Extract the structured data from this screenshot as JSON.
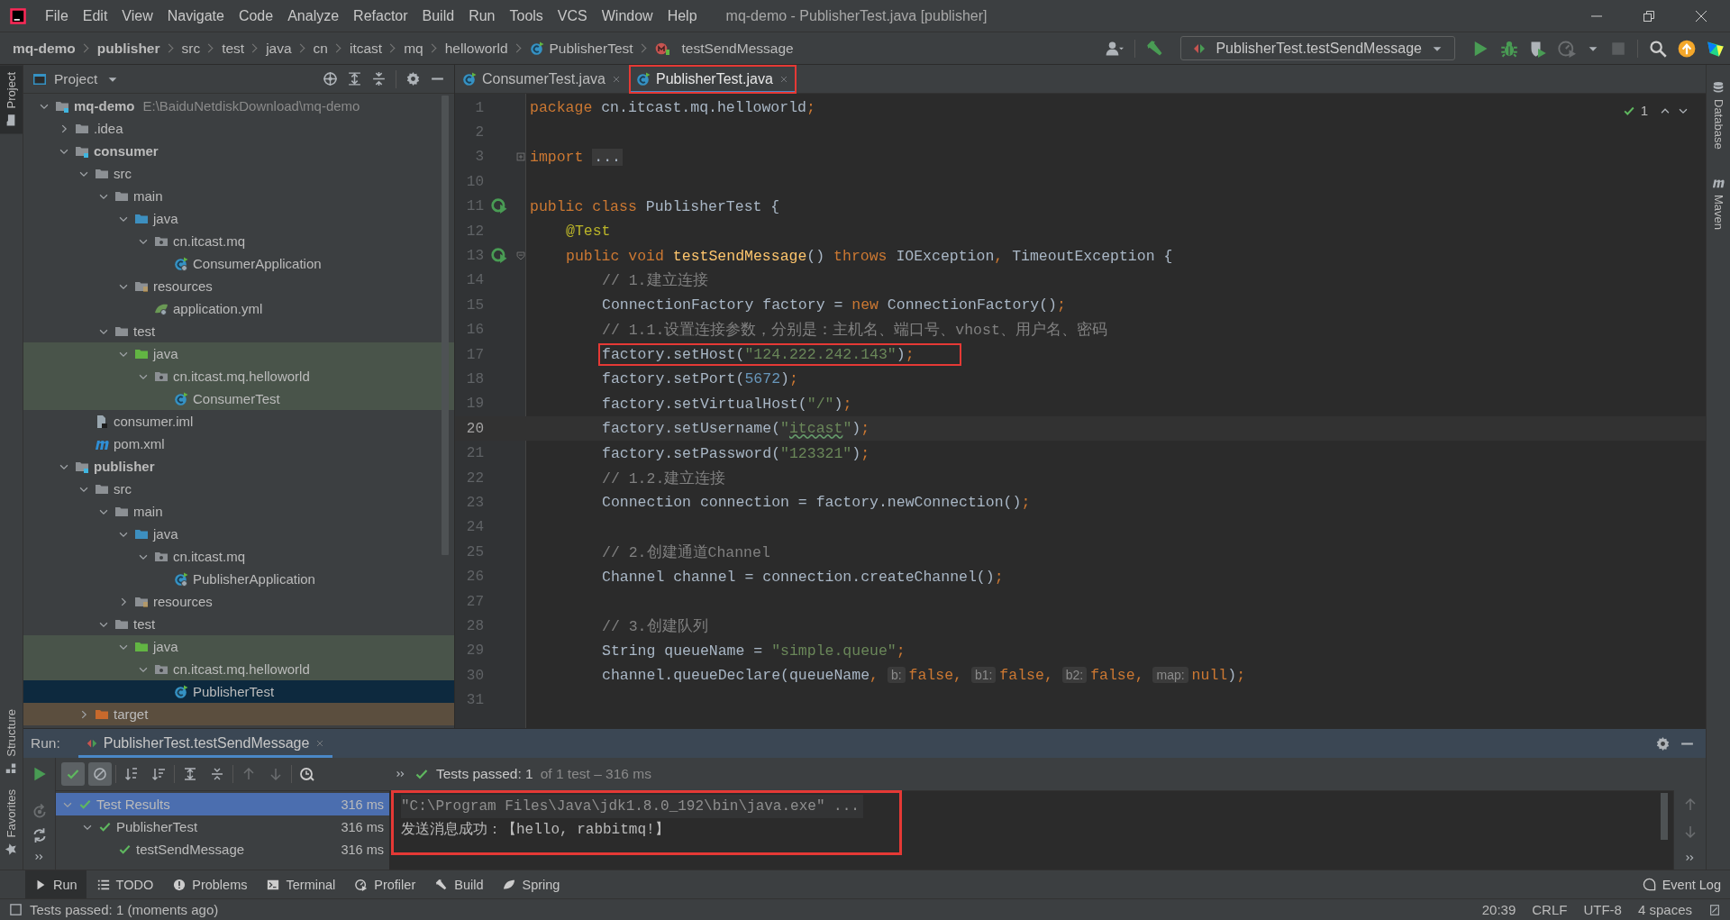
{
  "window": {
    "title": "mq-demo - PublisherTest.java [publisher]"
  },
  "menu": [
    "File",
    "Edit",
    "View",
    "Navigate",
    "Code",
    "Analyze",
    "Refactor",
    "Build",
    "Run",
    "Tools",
    "VCS",
    "Window",
    "Help"
  ],
  "breadcrumb": [
    {
      "label": "mq-demo",
      "kind": "project"
    },
    {
      "label": "publisher",
      "kind": "module"
    },
    {
      "label": "src",
      "kind": "dir"
    },
    {
      "label": "test",
      "kind": "dir"
    },
    {
      "label": "java",
      "kind": "dir"
    },
    {
      "label": "cn",
      "kind": "dir"
    },
    {
      "label": "itcast",
      "kind": "dir"
    },
    {
      "label": "mq",
      "kind": "dir"
    },
    {
      "label": "helloworld",
      "kind": "dir"
    },
    {
      "label": "PublisherTest",
      "kind": "class"
    },
    {
      "label": "testSendMessage",
      "kind": "method"
    }
  ],
  "run_config": {
    "label": "PublisherTest.testSendMessage"
  },
  "side_tools": {
    "left": [
      {
        "label": "Project",
        "selected": true
      },
      {
        "label": "Structure",
        "selected": false
      },
      {
        "label": "Favorites",
        "selected": false
      }
    ],
    "right": [
      {
        "label": "Database",
        "kind": "database"
      },
      {
        "label": "Maven",
        "kind": "maven"
      }
    ]
  },
  "project_panel": {
    "title": "Project",
    "tree": [
      {
        "label": "mq-demo",
        "kind": "project",
        "path": "E:\\BaiduNetdiskDownload\\mq-demo",
        "expanded": true,
        "selected": false,
        "children": [
          {
            "label": ".idea",
            "kind": "folder",
            "expanded": false,
            "selected": false
          },
          {
            "label": "consumer",
            "kind": "module",
            "expanded": true,
            "selected": false,
            "children": [
              {
                "label": "src",
                "kind": "folder",
                "expanded": true,
                "selected": false,
                "children": [
                  {
                    "label": "main",
                    "kind": "folder",
                    "expanded": true,
                    "selected": false,
                    "children": [
                      {
                        "label": "java",
                        "kind": "source_root",
                        "expanded": true,
                        "selected": false,
                        "children": [
                          {
                            "label": "cn.itcast.mq",
                            "kind": "package",
                            "expanded": true,
                            "selected": false,
                            "children": [
                              {
                                "label": "ConsumerApplication",
                                "kind": "spring_class",
                                "selected": false
                              }
                            ]
                          }
                        ]
                      },
                      {
                        "label": "resources",
                        "kind": "resources",
                        "expanded": true,
                        "selected": false,
                        "children": [
                          {
                            "label": "application.yml",
                            "kind": "yaml",
                            "selected": false
                          }
                        ]
                      }
                    ]
                  },
                  {
                    "label": "test",
                    "kind": "folder",
                    "expanded": true,
                    "selected": false,
                    "children": [
                      {
                        "label": "java",
                        "kind": "test_root",
                        "color": "#49544a",
                        "expanded": true,
                        "selected": false,
                        "children": [
                          {
                            "label": "cn.itcast.mq.helloworld",
                            "kind": "package",
                            "color": "#49544a",
                            "expanded": true,
                            "selected": false,
                            "children": [
                              {
                                "label": "ConsumerTest",
                                "kind": "test_class",
                                "color": "#49544a",
                                "selected": false
                              }
                            ]
                          }
                        ]
                      }
                    ]
                  }
                ]
              },
              {
                "label": "consumer.iml",
                "kind": "iml",
                "selected": false
              },
              {
                "label": "pom.xml",
                "kind": "maven",
                "selected": false
              }
            ]
          },
          {
            "label": "publisher",
            "kind": "module",
            "expanded": true,
            "selected": false,
            "children": [
              {
                "label": "src",
                "kind": "folder",
                "expanded": true,
                "selected": false,
                "children": [
                  {
                    "label": "main",
                    "kind": "folder",
                    "expanded": true,
                    "selected": false,
                    "children": [
                      {
                        "label": "java",
                        "kind": "source_root",
                        "expanded": true,
                        "selected": false,
                        "children": [
                          {
                            "label": "cn.itcast.mq",
                            "kind": "package",
                            "expanded": true,
                            "selected": false,
                            "children": [
                              {
                                "label": "PublisherApplication",
                                "kind": "spring_class",
                                "selected": false
                              }
                            ]
                          }
                        ]
                      },
                      {
                        "label": "resources",
                        "kind": "resources",
                        "expanded": false,
                        "selected": false
                      }
                    ]
                  },
                  {
                    "label": "test",
                    "kind": "folder",
                    "expanded": true,
                    "selected": false,
                    "children": [
                      {
                        "label": "java",
                        "kind": "test_root",
                        "color": "#49544a",
                        "expanded": true,
                        "selected": false,
                        "children": [
                          {
                            "label": "cn.itcast.mq.helloworld",
                            "kind": "package",
                            "color": "#49544a",
                            "expanded": true,
                            "selected": false,
                            "children": [
                              {
                                "label": "PublisherTest",
                                "kind": "test_class",
                                "selected": true
                              }
                            ]
                          }
                        ]
                      }
                    ]
                  }
                ]
              },
              {
                "label": "target",
                "kind": "excluded",
                "color": "#5b4e3e",
                "expanded": false,
                "selected": false
              }
            ]
          }
        ]
      }
    ]
  },
  "editor": {
    "tabs": [
      {
        "label": "ConsumerTest.java",
        "selected": false,
        "marked": false
      },
      {
        "label": "PublisherTest.java",
        "selected": true,
        "marked": true
      }
    ],
    "inspection": {
      "count": "1"
    },
    "lines": [
      {
        "number": "1",
        "current": false,
        "marked": false,
        "tokens": [
          {
            "kind": "kw",
            "text": "package "
          },
          {
            "kind": "p",
            "text": "cn.itcast.mq.helloworld"
          },
          {
            "kind": "kw",
            "text": ";"
          }
        ]
      },
      {
        "number": "2",
        "current": false,
        "marked": false
      },
      {
        "number": "3",
        "current": false,
        "marked": false,
        "folded": true,
        "tokens": [
          {
            "kind": "kw",
            "text": "import "
          },
          {
            "kind": "folded",
            "text": "..."
          }
        ]
      },
      {
        "number": "10",
        "current": false,
        "marked": false
      },
      {
        "number": "11",
        "current": false,
        "marked": false,
        "runnable": true,
        "tokens": [
          {
            "kind": "kw",
            "text": "public class "
          },
          {
            "kind": "p",
            "text": "PublisherTest {"
          }
        ],
        "children": [
          {
            "number": "12",
            "current": false,
            "marked": false,
            "tokens": [
              {
                "kind": "ann",
                "text": "@Test"
              }
            ]
          },
          {
            "number": "13",
            "current": false,
            "marked": false,
            "runnable": true,
            "foldable": true,
            "tokens": [
              {
                "kind": "kw",
                "text": "public void "
              },
              {
                "kind": "decl",
                "text": "testSendMessage"
              },
              {
                "kind": "p",
                "text": "() "
              },
              {
                "kind": "kw",
                "text": "throws "
              },
              {
                "kind": "p",
                "text": "IOException"
              },
              {
                "kind": "kw",
                "text": ", "
              },
              {
                "kind": "p",
                "text": "TimeoutException {"
              }
            ],
            "children": [
              {
                "number": "14",
                "current": false,
                "marked": false,
                "tokens": [
                  {
                    "kind": "cm",
                    "text": "// 1.建立连接"
                  }
                ]
              },
              {
                "number": "15",
                "current": false,
                "marked": false,
                "tokens": [
                  {
                    "kind": "p",
                    "text": "ConnectionFactory factory = "
                  },
                  {
                    "kind": "kw",
                    "text": "new "
                  },
                  {
                    "kind": "p",
                    "text": "ConnectionFactory()"
                  },
                  {
                    "kind": "kw",
                    "text": ";"
                  }
                ]
              },
              {
                "number": "16",
                "current": false,
                "marked": false,
                "tokens": [
                  {
                    "kind": "cm",
                    "text": "// 1.1.设置连接参数，分别是：主机名、端口号、vhost、用户名、密码"
                  }
                ]
              },
              {
                "number": "17",
                "current": false,
                "marked": true,
                "tokens": [
                  {
                    "kind": "p",
                    "text": "factory.setHost("
                  },
                  {
                    "kind": "str",
                    "text": "\"124.222.242.143\""
                  },
                  {
                    "kind": "p",
                    "text": ")"
                  },
                  {
                    "kind": "kw",
                    "text": ";"
                  }
                ]
              },
              {
                "number": "18",
                "current": false,
                "marked": false,
                "tokens": [
                  {
                    "kind": "p",
                    "text": "factory.setPort("
                  },
                  {
                    "kind": "num",
                    "text": "5672"
                  },
                  {
                    "kind": "p",
                    "text": ")"
                  },
                  {
                    "kind": "kw",
                    "text": ";"
                  }
                ]
              },
              {
                "number": "19",
                "current": false,
                "marked": false,
                "tokens": [
                  {
                    "kind": "p",
                    "text": "factory.setVirtualHost("
                  },
                  {
                    "kind": "str",
                    "text": "\"/\""
                  },
                  {
                    "kind": "p",
                    "text": ")"
                  },
                  {
                    "kind": "kw",
                    "text": ";"
                  }
                ]
              },
              {
                "number": "20",
                "current": true,
                "marked": false,
                "tokens": [
                  {
                    "kind": "p",
                    "text": "factory.setUsername("
                  },
                  {
                    "kind": "str",
                    "text": "\""
                  },
                  {
                    "kind": "typo",
                    "text": "itcast"
                  },
                  {
                    "kind": "str",
                    "text": "\""
                  },
                  {
                    "kind": "p",
                    "text": ")"
                  },
                  {
                    "kind": "kw",
                    "text": ";"
                  }
                ]
              },
              {
                "number": "21",
                "current": false,
                "marked": false,
                "tokens": [
                  {
                    "kind": "p",
                    "text": "factory.setPassword("
                  },
                  {
                    "kind": "str",
                    "text": "\"123321\""
                  },
                  {
                    "kind": "p",
                    "text": ")"
                  },
                  {
                    "kind": "kw",
                    "text": ";"
                  }
                ]
              },
              {
                "number": "22",
                "current": false,
                "marked": false,
                "tokens": [
                  {
                    "kind": "cm",
                    "text": "// 1.2.建立连接"
                  }
                ]
              },
              {
                "number": "23",
                "current": false,
                "marked": false,
                "tokens": [
                  {
                    "kind": "p",
                    "text": "Connection connection = factory.newConnection()"
                  },
                  {
                    "kind": "kw",
                    "text": ";"
                  }
                ]
              },
              {
                "number": "24",
                "current": false,
                "marked": false
              },
              {
                "number": "25",
                "current": false,
                "marked": false,
                "tokens": [
                  {
                    "kind": "cm",
                    "text": "// 2.创建通道Channel"
                  }
                ]
              },
              {
                "number": "26",
                "current": false,
                "marked": false,
                "tokens": [
                  {
                    "kind": "p",
                    "text": "Channel channel = connection.createChannel()"
                  },
                  {
                    "kind": "kw",
                    "text": ";"
                  }
                ]
              },
              {
                "number": "27",
                "current": false,
                "marked": false
              },
              {
                "number": "28",
                "current": false,
                "marked": false,
                "tokens": [
                  {
                    "kind": "cm",
                    "text": "// 3.创建队列"
                  }
                ]
              },
              {
                "number": "29",
                "current": false,
                "marked": false,
                "tokens": [
                  {
                    "kind": "p",
                    "text": "String queueName = "
                  },
                  {
                    "kind": "str",
                    "text": "\"simple.queue\""
                  },
                  {
                    "kind": "kw",
                    "text": ";"
                  }
                ]
              },
              {
                "number": "30",
                "current": false,
                "marked": false,
                "tokens": [
                  {
                    "kind": "p",
                    "text": "channel.queueDeclare(queueName"
                  },
                  {
                    "kind": "kw",
                    "text": ", "
                  },
                  {
                    "kind": "hint",
                    "text": "b:"
                  },
                  {
                    "kind": "kw",
                    "text": "false"
                  },
                  {
                    "kind": "kw",
                    "text": ", "
                  },
                  {
                    "kind": "hint",
                    "text": "b1:"
                  },
                  {
                    "kind": "kw",
                    "text": "false"
                  },
                  {
                    "kind": "kw",
                    "text": ", "
                  },
                  {
                    "kind": "hint",
                    "text": "b2:"
                  },
                  {
                    "kind": "kw",
                    "text": "false"
                  },
                  {
                    "kind": "kw",
                    "text": ", "
                  },
                  {
                    "kind": "hint",
                    "text": "map:"
                  },
                  {
                    "kind": "kw",
                    "text": "null"
                  },
                  {
                    "kind": "p",
                    "text": ")"
                  },
                  {
                    "kind": "kw",
                    "text": ";"
                  }
                ]
              },
              {
                "number": "31",
                "current": false,
                "marked": false
              }
            ]
          }
        ]
      }
    ]
  },
  "run_panel": {
    "title": "Run:",
    "tab": {
      "label": "PublisherTest.testSendMessage"
    },
    "toolbar": [
      {
        "kind": "passed",
        "on": true
      },
      {
        "kind": "ignored",
        "on": true
      },
      {
        "kind": "sort_alpha",
        "on": false
      },
      {
        "kind": "sort_duration",
        "on": false
      },
      {
        "kind": "expand",
        "on": false
      },
      {
        "kind": "collapse",
        "on": false
      },
      {
        "kind": "prev",
        "on": false
      },
      {
        "kind": "next",
        "on": false
      },
      {
        "kind": "history",
        "on": false
      }
    ],
    "summary": {
      "passed": "Tests passed: 1",
      "detail": "of 1 test – 316 ms"
    },
    "tests": [
      {
        "label": "Test Results",
        "time": "316 ms",
        "selected": true,
        "expanded": true,
        "children": [
          {
            "label": "PublisherTest",
            "time": "316 ms",
            "selected": false,
            "expanded": true,
            "children": [
              {
                "label": "testSendMessage",
                "time": "316 ms",
                "selected": false
              }
            ]
          }
        ]
      }
    ],
    "console": {
      "marked": true,
      "lines": [
        {
          "kind": "command",
          "text": "\"C:\\Program Files\\Java\\jdk1.8.0_192\\bin\\java.exe\" ..."
        },
        {
          "kind": "output",
          "text": "发送消息成功：【hello, rabbitmq!】"
        }
      ]
    }
  },
  "tool_windows": [
    {
      "label": "Run",
      "kind": "run",
      "selected": true
    },
    {
      "label": "TODO",
      "kind": "todo",
      "selected": false
    },
    {
      "label": "Problems",
      "kind": "problems",
      "selected": false
    },
    {
      "label": "Terminal",
      "kind": "terminal",
      "selected": false
    },
    {
      "label": "Profiler",
      "kind": "profiler",
      "selected": false
    },
    {
      "label": "Build",
      "kind": "build",
      "selected": false
    },
    {
      "label": "Spring",
      "kind": "spring",
      "selected": false
    }
  ],
  "event_log": {
    "label": "Event Log"
  },
  "status_bar": {
    "message": "Tests passed: 1 (moments ago)",
    "items": [
      "20:39",
      "CRLF",
      "UTF-8",
      "4 spaces"
    ]
  }
}
